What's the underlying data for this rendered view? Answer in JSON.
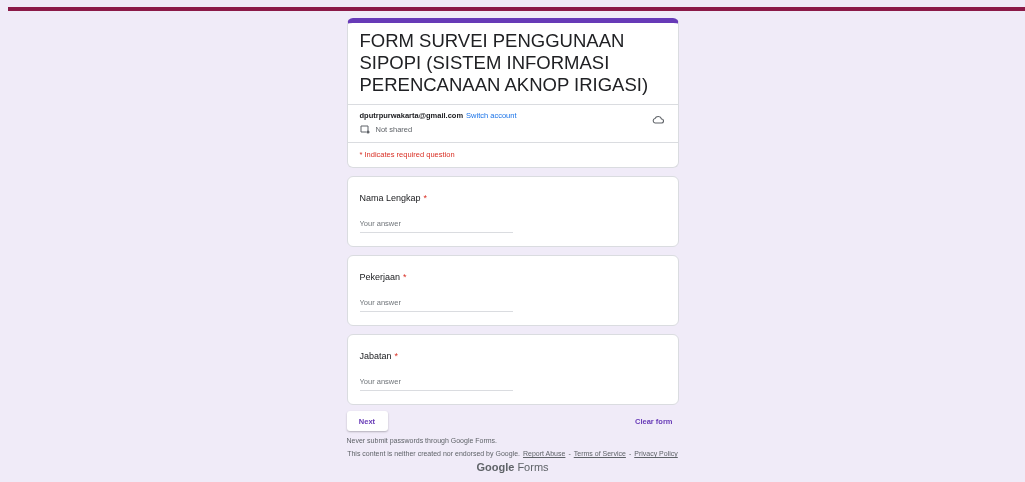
{
  "form": {
    "title": "FORM SURVEI PENGGUNAAN SIPOPI (SISTEM INFORMASI PERENCANAAN AKNOP IRIGASI)",
    "account": "dputrpurwakarta@gmail.com",
    "switch_account": "Switch account",
    "sharing": "Not shared",
    "required_note": "* Indicates required question"
  },
  "questions": [
    {
      "label": "Nama Lengkap",
      "required": true,
      "required_mark": "*",
      "placeholder": "Your answer"
    },
    {
      "label": "Pekerjaan",
      "required": true,
      "required_mark": "*",
      "placeholder": "Your answer"
    },
    {
      "label": "Jabatan",
      "required": true,
      "required_mark": "*",
      "placeholder": "Your answer"
    }
  ],
  "actions": {
    "next": "Next",
    "clear": "Clear form"
  },
  "footer": {
    "warning": "Never submit passwords through Google Forms.",
    "disclaimer": "This content is neither created nor endorsed by Google.",
    "links": [
      "Report Abuse",
      "Terms of Service",
      "Privacy Policy"
    ],
    "separator": "-",
    "logo": "**Google** Forms"
  }
}
